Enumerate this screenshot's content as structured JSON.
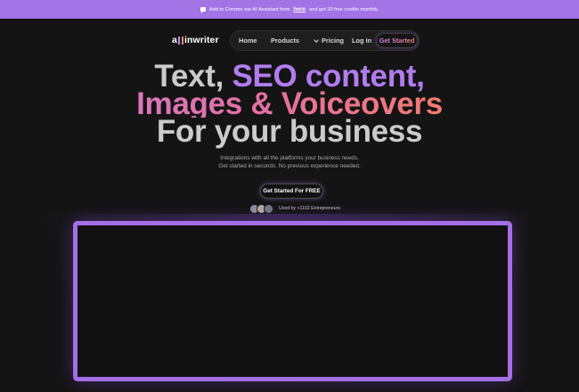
{
  "banner": {
    "prefix": "Add to Chrome our AI Assistant from",
    "link": "here",
    "suffix": "and get 20 free credits monthly."
  },
  "logo": {
    "text_a": "a",
    "text_b": "inwriter"
  },
  "nav": {
    "home": "Home",
    "products": "Products",
    "pricing": "Pricing",
    "login": "Log In",
    "get_started": "Get Started"
  },
  "hero": {
    "line1_a": "Text, ",
    "line1_b": "SEO content,",
    "line2": "Images & Voiceovers",
    "line3": "For your business"
  },
  "subtitle": {
    "line1": "Integrations with all the platforms your business needs.",
    "line2": "Get started in seconds. No previous experience needed."
  },
  "cta": {
    "label": "Get Started For FREE"
  },
  "social_proof": {
    "text": "Used by +1102 Entrepreneurs"
  },
  "colors": {
    "banner": "#a274e6",
    "background": "#141414",
    "accent_purple": "#b27cf0",
    "frame": "#a46ee4"
  }
}
